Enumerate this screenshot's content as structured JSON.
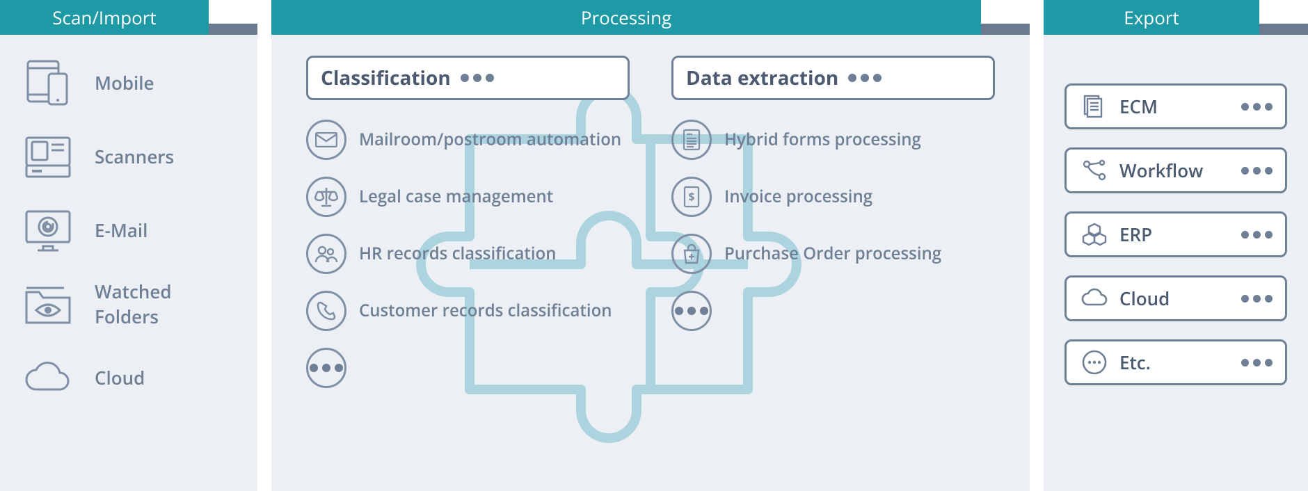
{
  "headers": {
    "scan": "Scan/Import",
    "processing": "Processing",
    "export": "Export"
  },
  "scan": {
    "items": [
      {
        "icon": "mobile-icon",
        "label": "Mobile"
      },
      {
        "icon": "scanner-icon",
        "label": "Scanners"
      },
      {
        "icon": "email-icon",
        "label": "E-Mail"
      },
      {
        "icon": "watched-folders-icon",
        "label": "Watched Folders"
      },
      {
        "icon": "cloud-icon",
        "label": "Cloud"
      }
    ]
  },
  "processing": {
    "columns": [
      {
        "title": "Classification",
        "items": [
          {
            "icon": "envelope-icon",
            "label": "Mailroom/postroom automation"
          },
          {
            "icon": "scales-icon",
            "label": "Legal case management"
          },
          {
            "icon": "people-icon",
            "label": "HR records classification"
          },
          {
            "icon": "phone-icon",
            "label": "Customer records classification"
          },
          {
            "icon": "more-icon",
            "label": ""
          }
        ]
      },
      {
        "title": "Data extraction",
        "items": [
          {
            "icon": "form-icon",
            "label": "Hybrid forms processing"
          },
          {
            "icon": "dollar-icon",
            "label": "Invoice processing"
          },
          {
            "icon": "bag-icon",
            "label": "Purchase Order processing"
          },
          {
            "icon": "more-icon",
            "label": ""
          }
        ]
      }
    ]
  },
  "export": {
    "items": [
      {
        "icon": "documents-icon",
        "label": "ECM"
      },
      {
        "icon": "workflow-icon",
        "label": "Workflow"
      },
      {
        "icon": "erp-icon",
        "label": "ERP"
      },
      {
        "icon": "cloud-small-icon",
        "label": "Cloud"
      },
      {
        "icon": "more-circle-icon",
        "label": "Etc."
      }
    ]
  }
}
